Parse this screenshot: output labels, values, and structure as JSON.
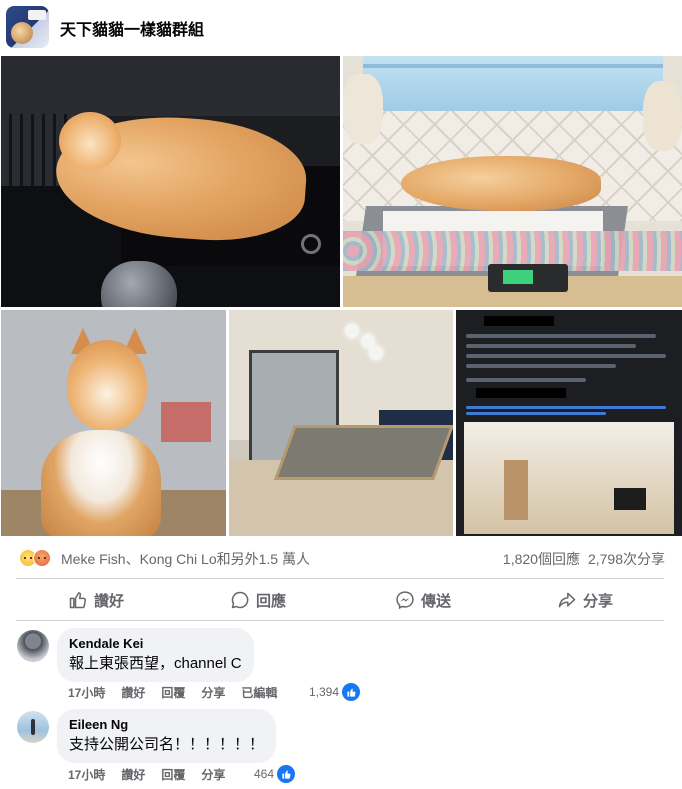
{
  "group": {
    "name": "天下貓貓一樣貓群組"
  },
  "post": {
    "photos": [
      {
        "description": "cat-on-desk"
      },
      {
        "description": "cat-on-memorial-platform"
      },
      {
        "description": "orange-cat-portrait"
      },
      {
        "description": "room-with-floor-board"
      },
      {
        "description": "dark-social-post-screenshot"
      }
    ]
  },
  "reactions": {
    "icons": [
      "sad-reaction-icon",
      "angry-reaction-icon"
    ],
    "names": "Meke Fish、Kong Chi Lo和另外1.5 萬人",
    "comments_count": "1,820個回應",
    "shares_count": "2,798次分享"
  },
  "actions": {
    "like_label": "讚好",
    "comment_label": "回應",
    "send_label": "傳送",
    "share_label": "分享"
  },
  "comments": [
    {
      "author": "Kendale Kei",
      "text": "報上東張西望，channel C",
      "time": "17小時",
      "like": "讚好",
      "reply": "回覆",
      "share": "分享",
      "edited": "已編輯",
      "likes": "1,394"
    },
    {
      "author": "Eileen Ng",
      "text": "支持公開公司名！！！！！！",
      "time": "17小時",
      "like": "讚好",
      "reply": "回覆",
      "share": "分享",
      "likes": "464"
    }
  ],
  "colors": {
    "text_primary": "#050505",
    "text_secondary": "#65676b",
    "bubble_bg": "#f0f2f5",
    "divider": "#ced0d4",
    "like_blue": "#1877f2"
  }
}
